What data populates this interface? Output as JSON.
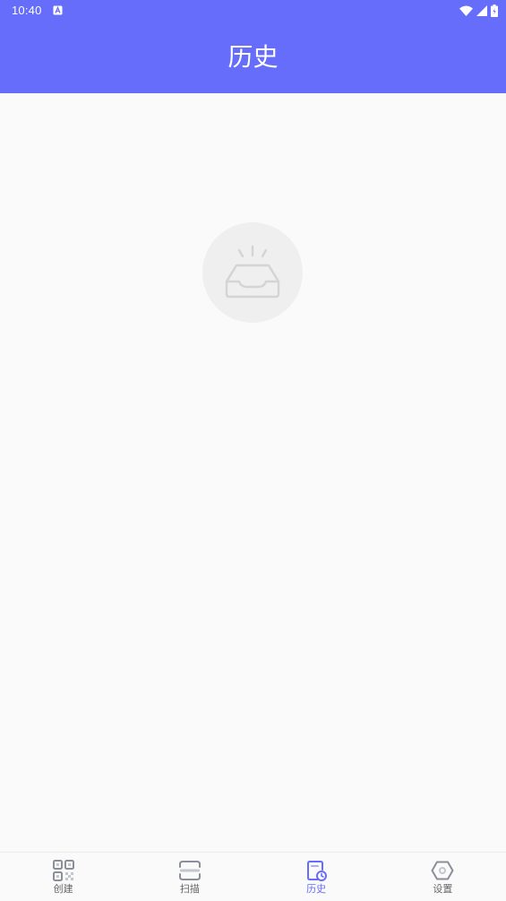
{
  "status_bar": {
    "time": "10:40",
    "icons": [
      "notification-a-icon",
      "wifi-icon",
      "signal-icon",
      "battery-icon"
    ]
  },
  "header": {
    "title": "历史",
    "background_color": "#666dfa"
  },
  "empty_state": {
    "icon": "empty-inbox-icon"
  },
  "bottom_nav": {
    "active_color": "#666dfa",
    "items": [
      {
        "label": "创建",
        "icon": "qr-code-icon",
        "active": false
      },
      {
        "label": "扫描",
        "icon": "scan-icon",
        "active": false
      },
      {
        "label": "历史",
        "icon": "history-doc-icon",
        "active": true
      },
      {
        "label": "设置",
        "icon": "settings-hexagon-icon",
        "active": false
      }
    ]
  }
}
